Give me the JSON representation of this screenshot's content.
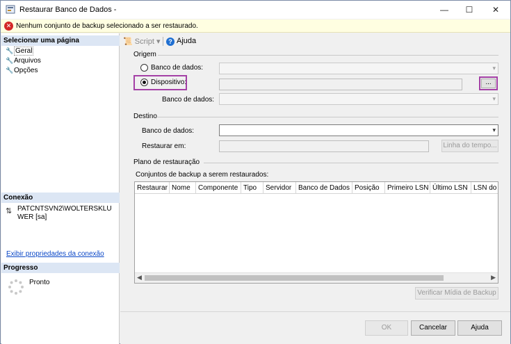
{
  "window": {
    "title": "Restaurar Banco de Dados -",
    "minimize": "—",
    "maximize": "☐",
    "close": "✕"
  },
  "error": {
    "message": "Nenhum conjunto de backup selecionado a ser restaurado."
  },
  "left": {
    "select_page_header": "Selecionar uma página",
    "pages": [
      {
        "label": "Geral"
      },
      {
        "label": "Arquivos"
      },
      {
        "label": "Opções"
      }
    ],
    "connection_header": "Conexão",
    "connection_value": "PATCNTSVN2\\WOLTERSKLUWER [sa]",
    "connection_link": "Exibir propriedades da conexão",
    "progress_header": "Progresso",
    "progress_status": "Pronto"
  },
  "toolbar": {
    "script_label": "Script",
    "help_label": "Ajuda"
  },
  "origin": {
    "title": "Origem",
    "radio_database_label": "Banco de dados:",
    "radio_device_label": "Dispositivo:",
    "browse_label": "...",
    "database_label": "Banco de dados:"
  },
  "destination": {
    "title": "Destino",
    "database_label": "Banco de dados:",
    "restore_to_label": "Restaurar em:",
    "timeline_label": "Linha do tempo..."
  },
  "plan": {
    "title": "Plano de restauração",
    "sets_label": "Conjuntos de backup a serem restaurados:",
    "columns": [
      "Restaurar",
      "Nome",
      "Componente",
      "Tipo",
      "Servidor",
      "Banco de Dados",
      "Posição",
      "Primeiro LSN",
      "Último LSN",
      "LSN do l"
    ],
    "verify_label": "Verificar Mídia de Backup"
  },
  "buttons": {
    "ok": "OK",
    "cancel": "Cancelar",
    "help": "Ajuda"
  }
}
